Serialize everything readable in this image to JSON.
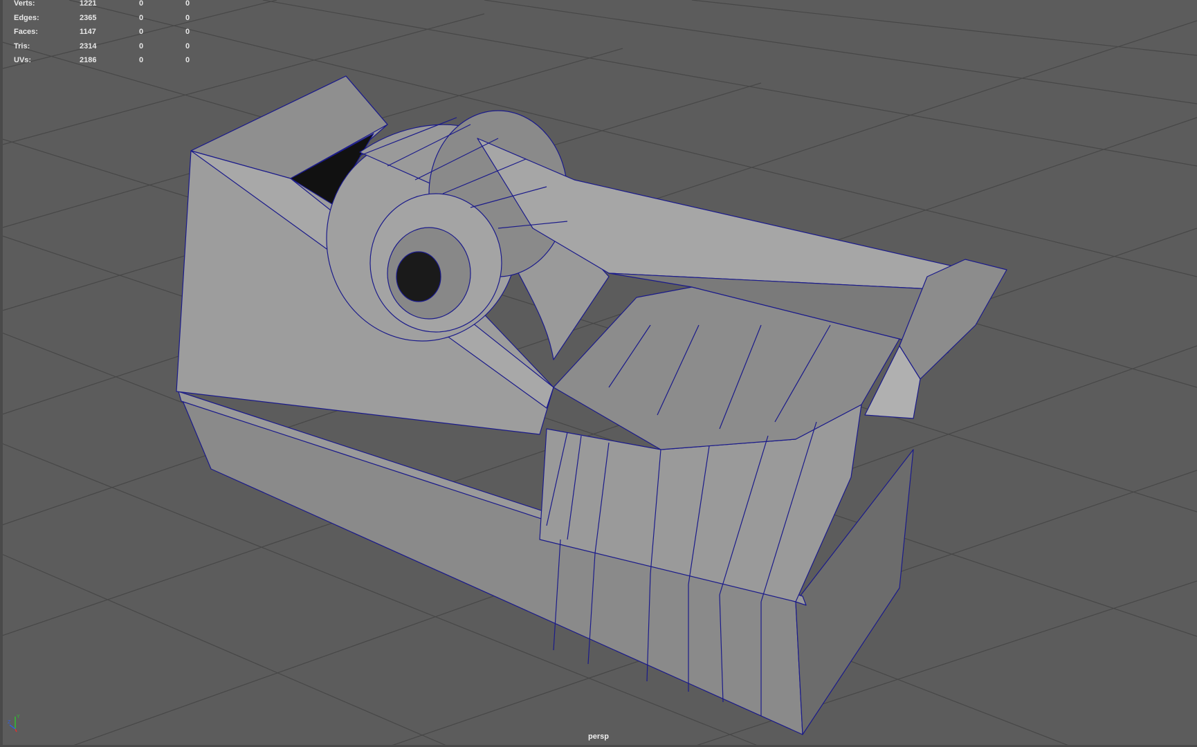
{
  "viewport": {
    "camera": "persp"
  },
  "hud": {
    "rows": [
      {
        "label": "Verts:",
        "v1": "1221",
        "v2": "0",
        "v3": "0"
      },
      {
        "label": "Edges:",
        "v1": "2365",
        "v2": "0",
        "v3": "0"
      },
      {
        "label": "Faces:",
        "v1": "1147",
        "v2": "0",
        "v3": "0"
      },
      {
        "label": "Tris:",
        "v1": "2314",
        "v2": "0",
        "v3": "0"
      },
      {
        "label": "UVs:",
        "v1": "2186",
        "v2": "0",
        "v3": "0"
      }
    ]
  },
  "axis_gizmo": {
    "x_label": "",
    "y_label": "Y",
    "z_label": "Z",
    "x_color": "#e03030",
    "y_color": "#30c030",
    "z_color": "#3060e0"
  },
  "colors": {
    "background": "#5c5c5c",
    "grid": "#474747",
    "mesh_light": "#a2a2a2",
    "mesh_mid": "#8e8e8e",
    "mesh_dark": "#6e6e6e",
    "wire": "#1a1a8a"
  }
}
